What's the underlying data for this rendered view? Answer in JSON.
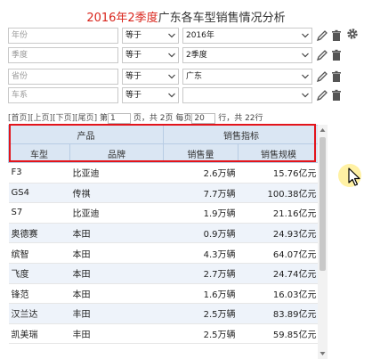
{
  "title": {
    "highlight": "2016年2季度",
    "rest": "广东各车型销售情况分析"
  },
  "filters": [
    {
      "field": "年份",
      "op": "等于",
      "value": "2016年"
    },
    {
      "field": "季度",
      "op": "等于",
      "value": "2季度"
    },
    {
      "field": "省份",
      "op": "等于",
      "value": "广东"
    },
    {
      "field": "车系",
      "op": "等于",
      "value": ""
    }
  ],
  "pager": {
    "first": "[首页]",
    "prev": "[上页]",
    "next": "[下页]",
    "last": "[尾页]",
    "page_prefix": "第",
    "current_page": "1",
    "page_mid": "页，共 2页 每页",
    "page_size": "20",
    "page_suffix": "行，共 22行"
  },
  "table": {
    "group_headers": [
      "产品",
      "销售指标"
    ],
    "columns": [
      "车型",
      "品牌",
      "销售量",
      "销售规模"
    ],
    "rows": [
      [
        "F3",
        "比亚迪",
        "2.6万辆",
        "15.76亿元"
      ],
      [
        "GS4",
        "传祺",
        "7.7万辆",
        "100.38亿元"
      ],
      [
        "S7",
        "比亚迪",
        "1.9万辆",
        "21.16亿元"
      ],
      [
        "奥德赛",
        "本田",
        "0.9万辆",
        "24.93亿元"
      ],
      [
        "缤智",
        "本田",
        "4.3万辆",
        "64.07亿元"
      ],
      [
        "飞度",
        "本田",
        "2.7万辆",
        "24.74亿元"
      ],
      [
        "锋范",
        "本田",
        "1.6万辆",
        "16.03亿元"
      ],
      [
        "汉兰达",
        "丰田",
        "2.5万辆",
        "83.89亿元"
      ],
      [
        "凯美瑞",
        "丰田",
        "2.5万辆",
        "59.85亿元"
      ]
    ]
  },
  "colors": {
    "title_highlight": "#d9251c",
    "header_bg": "#dae6f3",
    "highlight_box": "#e3141b"
  },
  "icons": [
    "chevron-down-icon",
    "edit-icon",
    "delete-icon",
    "gear-icon",
    "mouse-cursor-icon"
  ]
}
